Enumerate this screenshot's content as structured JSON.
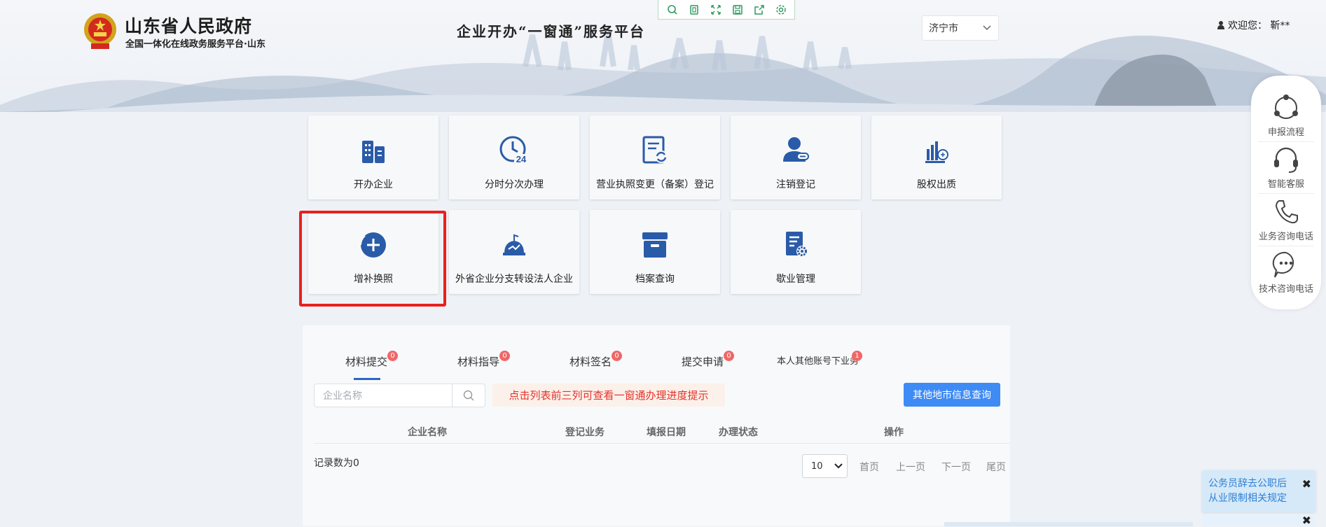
{
  "header": {
    "site_title": "山东省人民政府",
    "site_subtitle": "全国一体化在线政务服务平台·山东",
    "platform_title": "企业开办“一窗通”服务平台",
    "city_select": {
      "value": "济宁市"
    },
    "welcome": "欢迎您： 靳**"
  },
  "toolbar": {
    "icons": [
      "search-icon",
      "copy-icon",
      "fullscreen-icon",
      "save-icon",
      "share-icon",
      "settings-icon"
    ]
  },
  "services": [
    {
      "label": "开办企业",
      "icon": "buildings-icon"
    },
    {
      "label": "分时分次办理",
      "icon": "clock-24-icon"
    },
    {
      "label": "营业执照变更（备案）登记",
      "icon": "document-refresh-icon"
    },
    {
      "label": "注销登记",
      "icon": "user-remove-icon"
    },
    {
      "label": "股权出质",
      "icon": "chart-stamp-icon"
    },
    {
      "label": "增补换照",
      "icon": "plus-circle-icon"
    },
    {
      "label": "外省企业分支转设法人企业",
      "icon": "branch-move-icon"
    },
    {
      "label": "档案查询",
      "icon": "archive-box-icon"
    },
    {
      "label": "歇业管理",
      "icon": "document-gear-icon"
    }
  ],
  "tabs": [
    {
      "label": "材料提交",
      "badge": "0"
    },
    {
      "label": "材料指导",
      "badge": "0"
    },
    {
      "label": "材料签名",
      "badge": "0"
    },
    {
      "label": "提交申请",
      "badge": "0"
    },
    {
      "label": "本人其他账号下业务",
      "badge": "1"
    }
  ],
  "search": {
    "placeholder": "企业名称",
    "value": ""
  },
  "hint": "点击列表前三列可查看一窗通办理进度提示",
  "other_city_button": "其他地市信息查询",
  "table": {
    "columns": [
      "企业名称",
      "登记业务",
      "填报日期",
      "办理状态",
      "操作"
    ],
    "rows": []
  },
  "pagination": {
    "record_count": "记录数为0",
    "page_size": "10",
    "first": "首页",
    "prev": "上一页",
    "next": "下一页",
    "last": "尾页"
  },
  "sidebar": [
    {
      "label": "申报流程",
      "icon": "flow-icon"
    },
    {
      "label": "智能客服",
      "icon": "headset-icon"
    },
    {
      "label": "业务咨询电话",
      "icon": "phone-icon"
    },
    {
      "label": "技术咨询电话",
      "icon": "chat-bubble-icon"
    }
  ],
  "notice": {
    "text": "公务员辞去公职后从业限制相关规定",
    "close": "✖"
  },
  "colors": {
    "accent": "#3e8bf5",
    "icon_blue": "#2a5ba8",
    "highlight": "#e8201f",
    "badge": "#f06767"
  }
}
